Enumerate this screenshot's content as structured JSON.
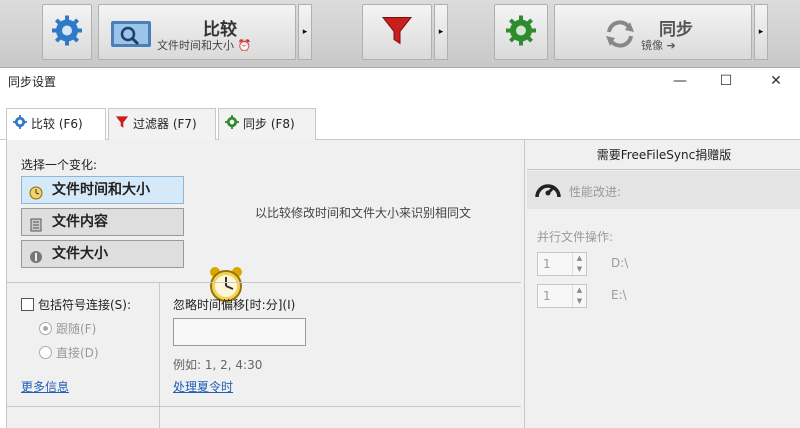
{
  "toolbar": {
    "compare_title": "比较",
    "compare_subtitle": "文件时间和大小",
    "sync_title": "同步",
    "sync_subtitle": "镜像 ➔",
    "arrow": "▸"
  },
  "dialog": {
    "title": "同步设置",
    "minimize": "—",
    "maximize": "☐",
    "close": "✕"
  },
  "tabs": [
    {
      "label": "比较 (F6)"
    },
    {
      "label": "过滤器 (F7)"
    },
    {
      "label": "同步 (F8)"
    }
  ],
  "compare": {
    "choose_label": "选择一个变化:",
    "variants": [
      {
        "label": "文件时间和大小",
        "selected": true
      },
      {
        "label": "文件内容",
        "selected": false
      },
      {
        "label": "文件大小",
        "selected": false
      }
    ],
    "hint": "以比较修改时间和文件大小来识别相同文",
    "symlink_label": "包括符号连接(S):",
    "follow_label": "跟随(F)",
    "direct_label": "直接(D)",
    "more_info": "更多信息",
    "ignore_time_label": "忽略时间偏移[时:分](I)",
    "ignore_time_value": "",
    "example": "例如: 1, 2, 4:30",
    "dst_link": "处理夏令时"
  },
  "right_panel": {
    "donation": "需要FreeFileSync捐赠版",
    "performance": "性能改进:",
    "parallel_ops": "并行文件操作:",
    "rows": [
      {
        "value": "1",
        "drive": "D:\\"
      },
      {
        "value": "1",
        "drive": "E:\\"
      }
    ]
  },
  "colors": {
    "accent_blue": "#2f79c8",
    "filter_red": "#c81e1e",
    "sync_green": "#2e8b2e",
    "link": "#1f5fb5"
  }
}
